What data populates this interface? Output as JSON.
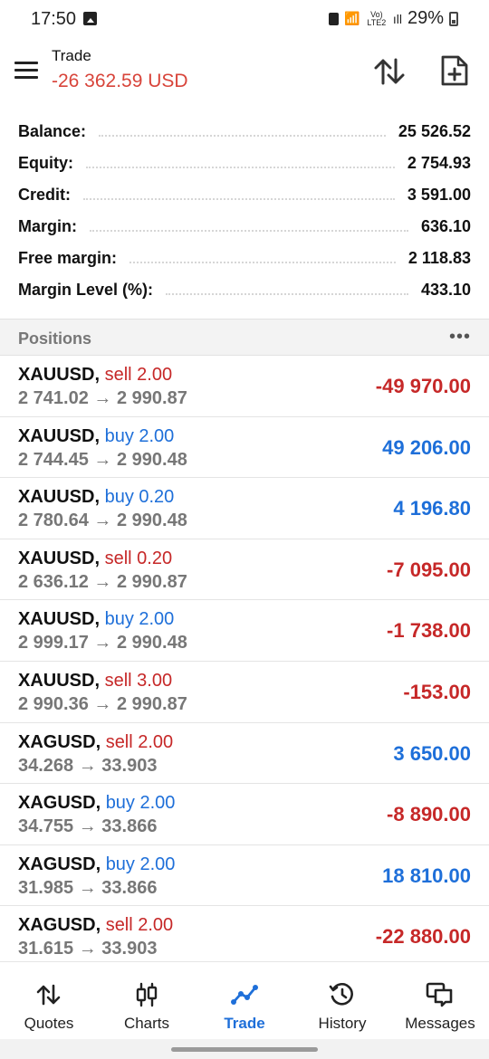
{
  "status_bar": {
    "time": "17:50",
    "battery": "29%",
    "network": "Vo) LTE2"
  },
  "header": {
    "title": "Trade",
    "total_profit": "-26 362.59 USD"
  },
  "summary": [
    {
      "label": "Balance:",
      "value": "25 526.52"
    },
    {
      "label": "Equity:",
      "value": "2 754.93"
    },
    {
      "label": "Credit:",
      "value": "3 591.00"
    },
    {
      "label": "Margin:",
      "value": "636.10"
    },
    {
      "label": "Free margin:",
      "value": "2 118.83"
    },
    {
      "label": "Margin Level (%):",
      "value": "433.10"
    }
  ],
  "positions_section": {
    "title": "Positions",
    "more": "•••"
  },
  "positions": [
    {
      "symbol": "XAUUSD,",
      "side": "sell 2.00",
      "prices": "2 741.02 → 2 990.87",
      "profit": "-49 970.00",
      "positive": false
    },
    {
      "symbol": "XAUUSD,",
      "side": "buy 2.00",
      "prices": "2 744.45 → 2 990.48",
      "profit": "49 206.00",
      "positive": true
    },
    {
      "symbol": "XAUUSD,",
      "side": "buy 0.20",
      "prices": "2 780.64 → 2 990.48",
      "profit": "4 196.80",
      "positive": true
    },
    {
      "symbol": "XAUUSD,",
      "side": "sell 0.20",
      "prices": "2 636.12 → 2 990.87",
      "profit": "-7 095.00",
      "positive": false
    },
    {
      "symbol": "XAUUSD,",
      "side": "buy 2.00",
      "prices": "2 999.17 → 2 990.48",
      "profit": "-1 738.00",
      "positive": false
    },
    {
      "symbol": "XAUUSD,",
      "side": "sell 3.00",
      "prices": "2 990.36 → 2 990.87",
      "profit": "-153.00",
      "positive": false
    },
    {
      "symbol": "XAGUSD,",
      "side": "sell 2.00",
      "prices": "34.268 → 33.903",
      "profit": "3 650.00",
      "positive": true
    },
    {
      "symbol": "XAGUSD,",
      "side": "buy 2.00",
      "prices": "34.755 → 33.866",
      "profit": "-8 890.00",
      "positive": false
    },
    {
      "symbol": "XAGUSD,",
      "side": "buy 2.00",
      "prices": "31.985 → 33.866",
      "profit": "18 810.00",
      "positive": true
    },
    {
      "symbol": "XAGUSD,",
      "side": "sell 2.00",
      "prices": "31.615 → 33.903",
      "profit": "-22 880.00",
      "positive": false
    }
  ],
  "bottom_nav": [
    {
      "label": "Quotes",
      "icon": "quotes-arrows-icon",
      "active": false
    },
    {
      "label": "Charts",
      "icon": "candlestick-icon",
      "active": false
    },
    {
      "label": "Trade",
      "icon": "trade-line-icon",
      "active": true
    },
    {
      "label": "History",
      "icon": "history-clock-icon",
      "active": false
    },
    {
      "label": "Messages",
      "icon": "messages-icon",
      "active": false
    }
  ],
  "colors": {
    "negative": "#c62828",
    "positive": "#1e6fd9",
    "header_profit": "#d8443a"
  }
}
